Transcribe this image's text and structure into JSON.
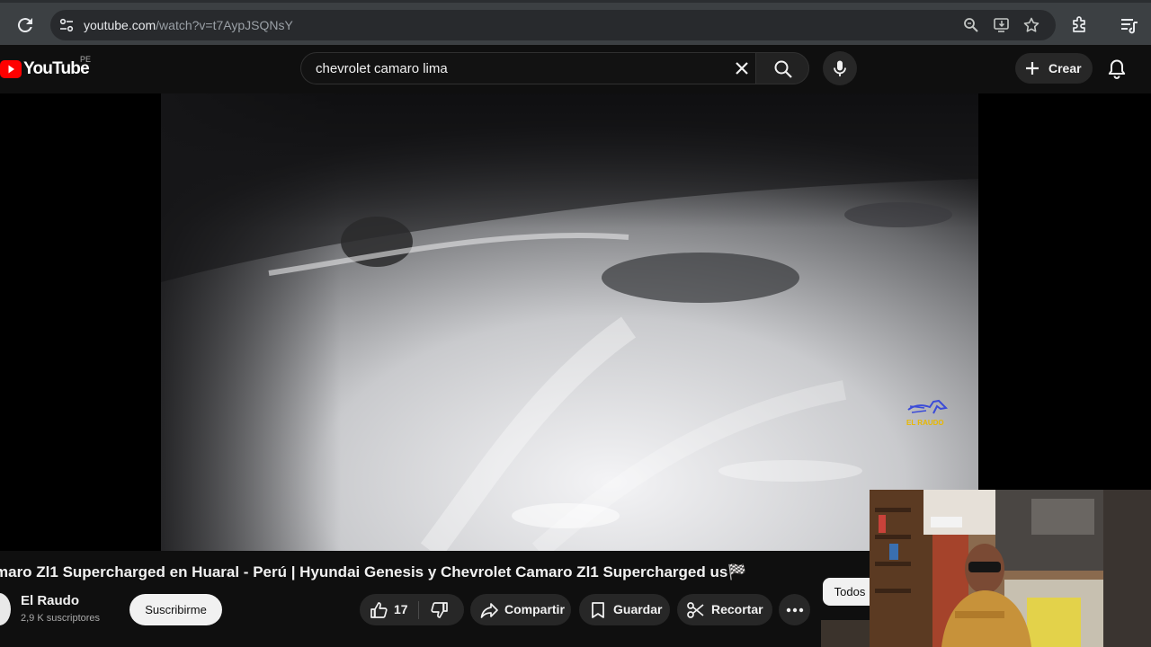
{
  "browser": {
    "url_host": "youtube.com",
    "url_path": "/watch?v=t7AypJSQNsY",
    "icons": [
      "reload-icon",
      "site-settings-icon",
      "zoom-icon",
      "install-app-icon",
      "bookmark-star-icon",
      "extensions-icon",
      "reading-list-icon"
    ]
  },
  "masthead": {
    "logo_text": "YouTube",
    "country_code": "PE",
    "search_query": "chevrolet camaro lima",
    "create_label": "Crear"
  },
  "player": {
    "watermark_text": "EL RAUDO"
  },
  "video": {
    "title": "maro Zl1 Supercharged en Huaral - Perú | Hyundai Genesis y Chevrolet Camaro Zl1 Supercharged us🏁",
    "channel_name": "El Raudo",
    "subscribers": "2,9 K suscriptores",
    "subscribe_label": "Suscribirme",
    "like_count": "17",
    "share_label": "Compartir",
    "save_label": "Guardar",
    "clip_label": "Recortar"
  },
  "sidebar": {
    "chip_all": "Todos"
  },
  "colors": {
    "accent_red": "#ff0000",
    "background": "#0f0f0f",
    "chrome": "#3c4043"
  }
}
